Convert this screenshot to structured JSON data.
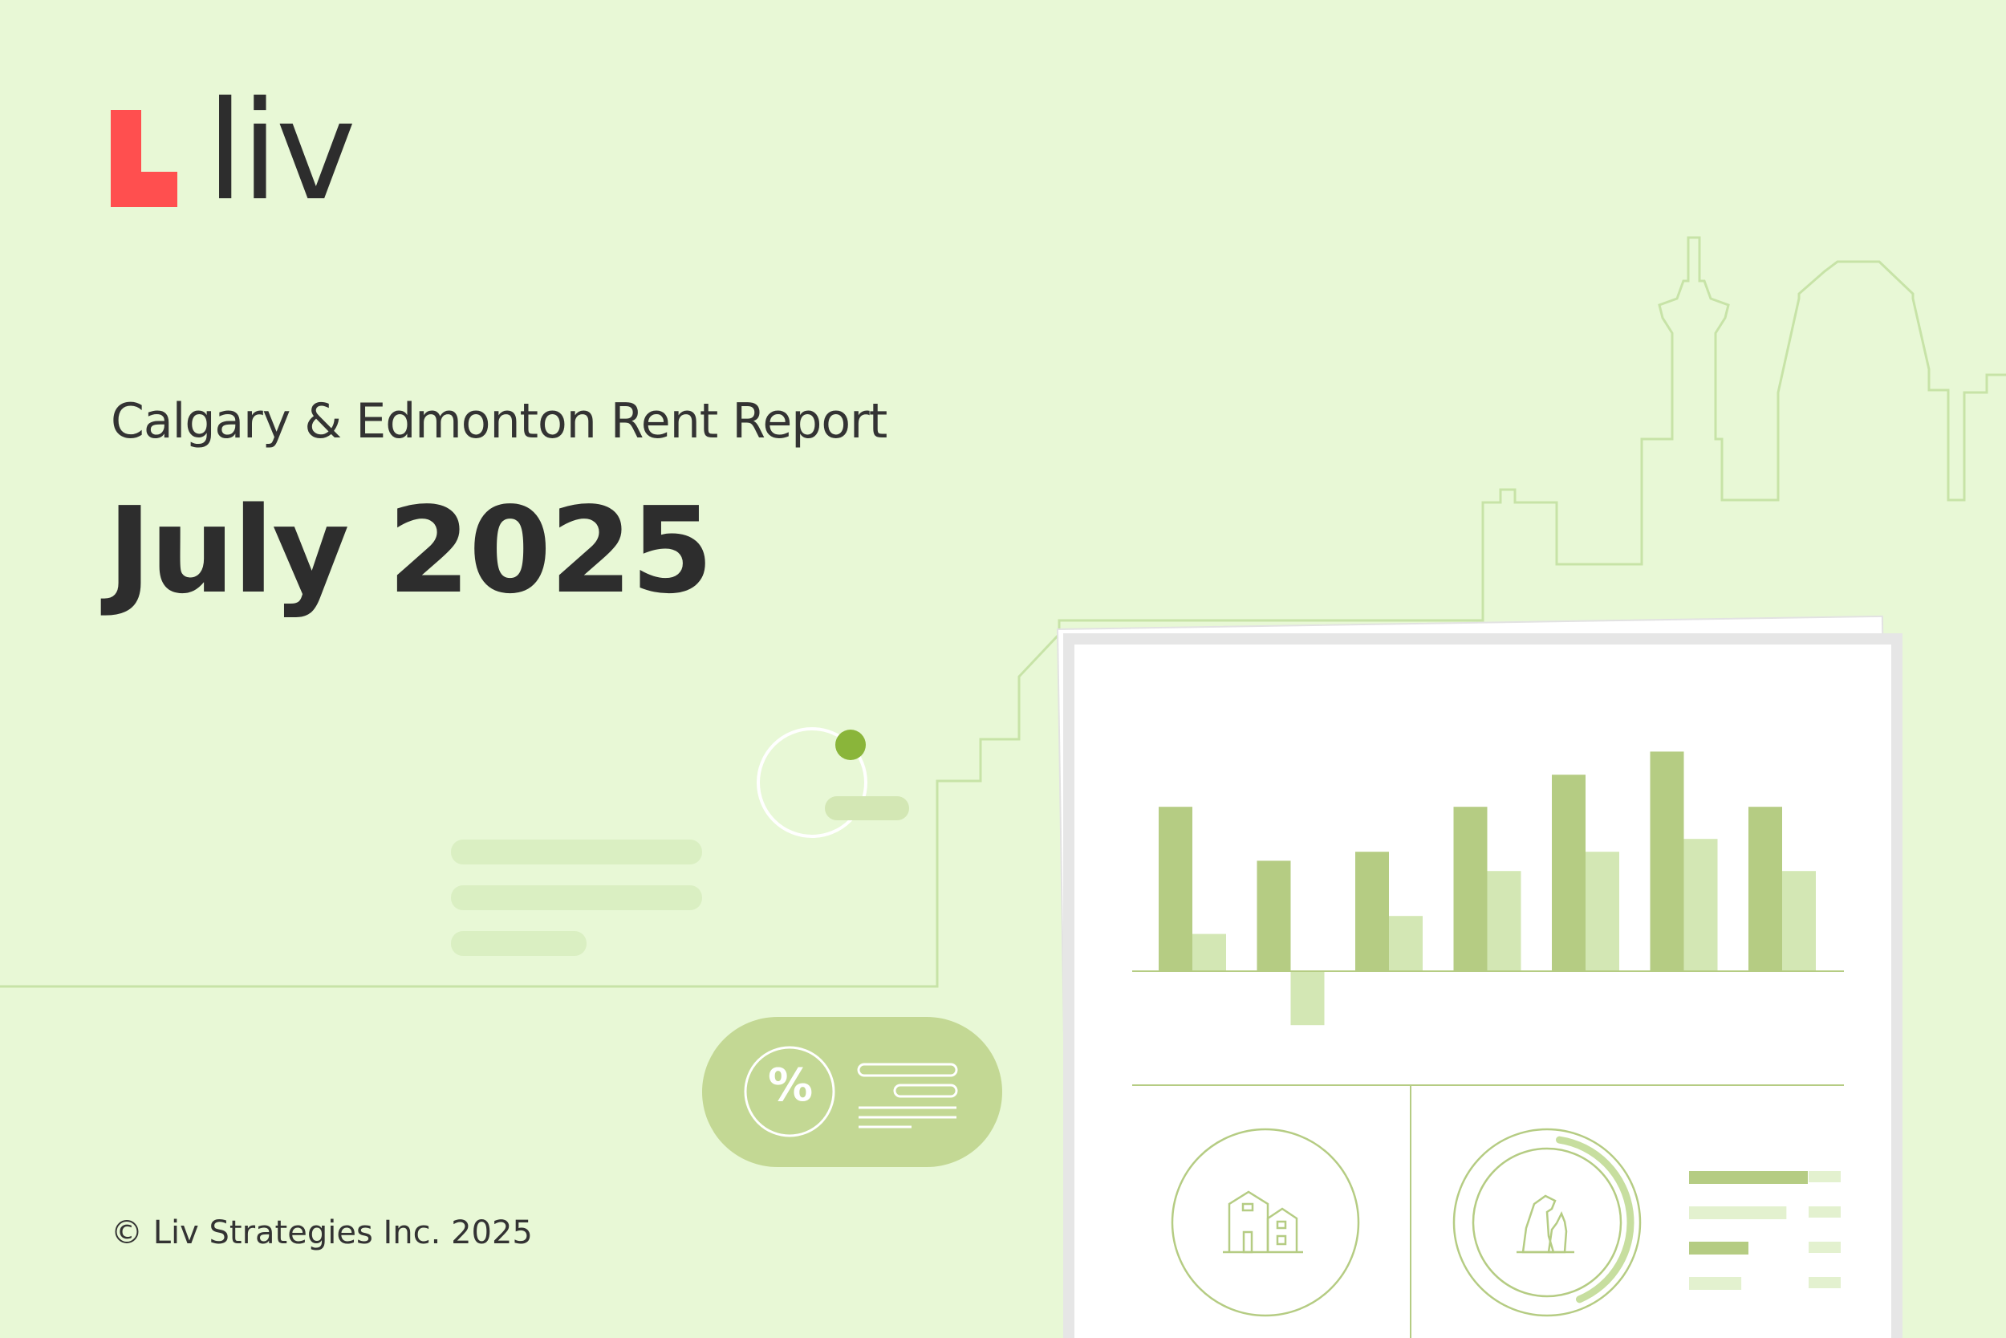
{
  "brand": {
    "name": "liv",
    "logo_color": "#ff4f4f",
    "text_color": "#2d2d2d"
  },
  "report": {
    "subtitle": "Calgary & Edmonton Rent Report",
    "title": "July 2025"
  },
  "footer": {
    "copyright": "© Liv Strategies Inc. 2025"
  },
  "badge": {
    "symbol": "%"
  },
  "colors": {
    "background": "#e8f8d6",
    "skyline_line": "#c7e3a7",
    "bar_dark": "#b5cc83",
    "bar_light": "#d3e7b4",
    "accent_dot": "#8ab53a",
    "badge_fill": "#c3d894"
  },
  "icons": {
    "logo": "liv-logo-icon",
    "percent": "percent-icon",
    "houses": "houses-icon",
    "pets": "pet-icon"
  },
  "chart_data": {
    "type": "bar",
    "note_on_units": "decorative illustration, no axis printed; values in arbitrary units",
    "categories": [
      "",
      "",
      "",
      "",
      "",
      "",
      ""
    ],
    "series": [
      {
        "values": [
          12.8,
          8.6,
          9.3,
          12.8,
          15.3,
          17.1,
          12.8
        ]
      },
      {
        "values": [
          2.9,
          -4.2,
          4.3,
          7.8,
          9.3,
          10.3,
          7.8
        ]
      }
    ],
    "ylim": [
      -5,
      18
    ],
    "grid": false,
    "legend": "none"
  },
  "mini_bars": {
    "progress_ring": 0.55,
    "levels": [
      1.0,
      0.82,
      0.5,
      0.44
    ]
  }
}
